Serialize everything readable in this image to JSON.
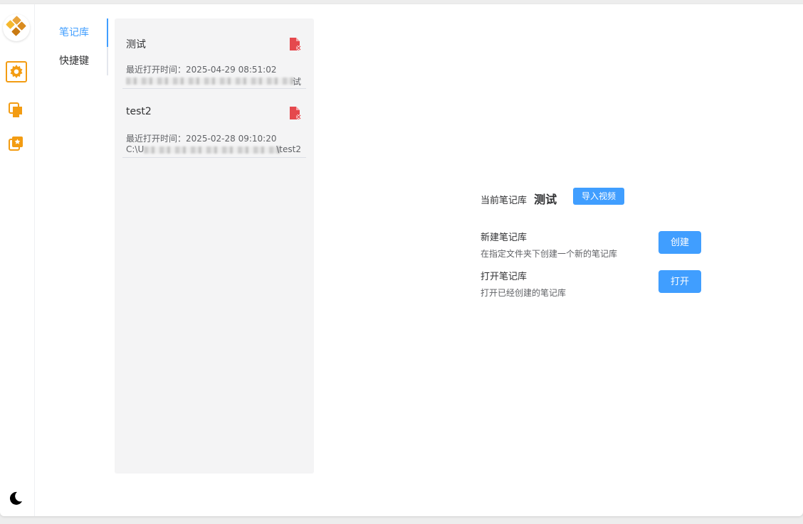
{
  "sidebar": {
    "logo_icon": "diamond-logo-icon",
    "items": [
      {
        "icon": "gear-icon",
        "active": true
      },
      {
        "icon": "note-cards-icon",
        "active": false
      },
      {
        "icon": "star-collection-icon",
        "active": false
      }
    ],
    "theme_icon": "moon-icon"
  },
  "settings_nav": {
    "items": [
      {
        "label": "笔记库",
        "active": true
      },
      {
        "label": "快捷键",
        "active": false
      }
    ]
  },
  "libraries": [
    {
      "name": "测试",
      "time_label": "最近打开时间：",
      "time": "2025-04-29 08:51:02",
      "path_prefix": "",
      "path_suffix": "试"
    },
    {
      "name": "test2",
      "time_label": "最近打开时间：",
      "time": "2025-02-28 09:10:20",
      "path_prefix": "C:\\U",
      "path_suffix": "\\test2"
    }
  ],
  "main": {
    "current_label": "当前笔记库",
    "current_name": "测试",
    "import_button": "导入视频",
    "new_section": {
      "title": "新建笔记库",
      "desc": "在指定文件夹下创建一个新的笔记库",
      "button": "创建"
    },
    "open_section": {
      "title": "打开笔记库",
      "desc": "打开已经创建的笔记库",
      "button": "打开"
    }
  },
  "colors": {
    "accent": "#409eff",
    "brand_orange": "#f39c12",
    "danger": "#e74c3c"
  }
}
